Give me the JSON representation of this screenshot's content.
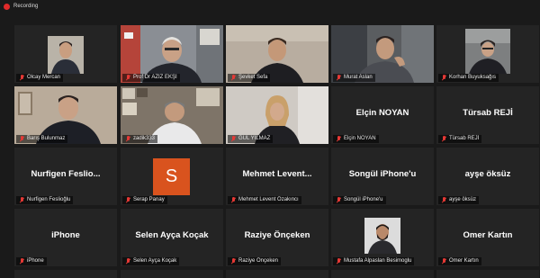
{
  "recording": {
    "label": "Recording",
    "dot_color": "#e02a2a"
  },
  "active_speaker_color": "#b7e04a",
  "tiles": [
    {
      "name": "Olcay Mercan",
      "type": "photo",
      "display": ""
    },
    {
      "name": "Prof Dr AZİZ EKŞİ",
      "type": "video",
      "display": ""
    },
    {
      "name": "Şevket Sefa",
      "type": "video",
      "display": ""
    },
    {
      "name": "Murat Aslan",
      "type": "video",
      "display": "",
      "active": true
    },
    {
      "name": "Korhan Buyuksağıs",
      "type": "photo",
      "display": ""
    },
    {
      "name": "Barış Bulunmaz",
      "type": "video",
      "display": ""
    },
    {
      "name": "zadik333",
      "type": "video",
      "display": ""
    },
    {
      "name": "GUL YILMAZ",
      "type": "video",
      "display": ""
    },
    {
      "name": "Elçin NOYAN",
      "type": "name",
      "display": "Elçin NOYAN"
    },
    {
      "name": "Türsab REJİ",
      "type": "name",
      "display": "Türsab REJİ"
    },
    {
      "name": "Nurfigen Feslioğlu",
      "type": "name",
      "display": "Nurfigen Feslio..."
    },
    {
      "name": "Serap Panay",
      "type": "initial",
      "display": "S"
    },
    {
      "name": "Mehmet Levent Özakıncı",
      "type": "name",
      "display": "Mehmet Levent..."
    },
    {
      "name": "Songül iPhone'u",
      "type": "name",
      "display": "Songül iPhone'u"
    },
    {
      "name": "ayşe öksüz",
      "type": "name",
      "display": "ayşe öksüz"
    },
    {
      "name": "iPhone",
      "type": "name",
      "display": "iPhone"
    },
    {
      "name": "Selen Ayça Koçak",
      "type": "name",
      "display": "Selen Ayça Koçak"
    },
    {
      "name": "Raziye Önçeken",
      "type": "name",
      "display": "Raziye Önçeken"
    },
    {
      "name": "Mustafa Alpaslan Besimoglu",
      "type": "photo-center",
      "display": ""
    },
    {
      "name": "Omer Kartın",
      "type": "name",
      "display": "Omer Kartın"
    }
  ]
}
